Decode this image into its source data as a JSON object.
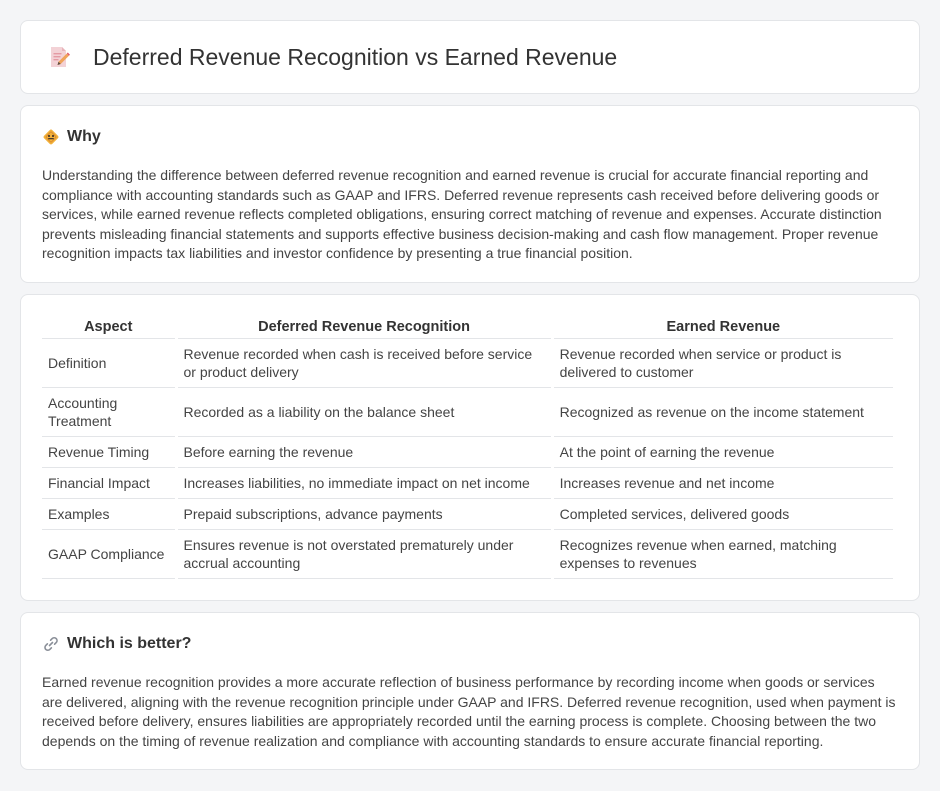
{
  "header": {
    "title": "Deferred Revenue Recognition vs Earned Revenue"
  },
  "why": {
    "heading": "Why",
    "text": "Understanding the difference between deferred revenue recognition and earned revenue is crucial for accurate financial reporting and compliance with accounting standards such as GAAP and IFRS. Deferred revenue represents cash received before delivering goods or services, while earned revenue reflects completed obligations, ensuring correct matching of revenue and expenses. Accurate distinction prevents misleading financial statements and supports effective business decision-making and cash flow management. Proper revenue recognition impacts tax liabilities and investor confidence by presenting a true financial position."
  },
  "comparison": {
    "headers": [
      "Aspect",
      "Deferred Revenue Recognition",
      "Earned Revenue"
    ],
    "rows": [
      [
        "Definition",
        "Revenue recorded when cash is received before service or product delivery",
        "Revenue recorded when service or product is delivered to customer"
      ],
      [
        "Accounting Treatment",
        "Recorded as a liability on the balance sheet",
        "Recognized as revenue on the income statement"
      ],
      [
        "Revenue Timing",
        "Before earning the revenue",
        "At the point of earning the revenue"
      ],
      [
        "Financial Impact",
        "Increases liabilities, no immediate impact on net income",
        "Increases revenue and net income"
      ],
      [
        "Examples",
        "Prepaid subscriptions, advance payments",
        "Completed services, delivered goods"
      ],
      [
        "GAAP Compliance",
        "Ensures revenue is not overstated prematurely under accrual accounting",
        "Recognizes revenue when earned, matching expenses to revenues"
      ]
    ]
  },
  "better": {
    "heading": "Which is better?",
    "text": "Earned revenue recognition provides a more accurate reflection of business performance by recording income when goods or services are delivered, aligning with the revenue recognition principle under GAAP and IFRS. Deferred revenue recognition, used when payment is received before delivery, ensures liabilities are appropriately recorded until the earning process is complete. Choosing between the two depends on the timing of revenue realization and compliance with accounting standards to ensure accurate financial reporting."
  },
  "icons": {
    "title": "document-pencil-icon",
    "why": "diamond-sign-icon",
    "better": "link-icon"
  }
}
